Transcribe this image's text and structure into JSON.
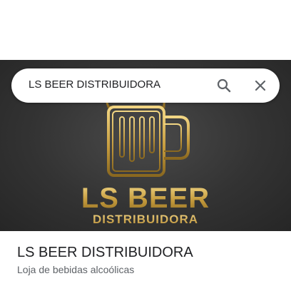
{
  "search": {
    "query": "LS BEER DISTRIBUIDORA"
  },
  "hero_logo": {
    "brand_line1": "LS BEER",
    "brand_line2": "DISTRIBUIDORA",
    "gold_color": "#c9a24a",
    "background_color": "#333333"
  },
  "place": {
    "name": "LS BEER DISTRIBUIDORA",
    "category": "Loja de bebidas alcoólicas"
  },
  "icons": {
    "search": "search-icon",
    "close": "close-icon",
    "logo": "beer-mug-icon"
  }
}
